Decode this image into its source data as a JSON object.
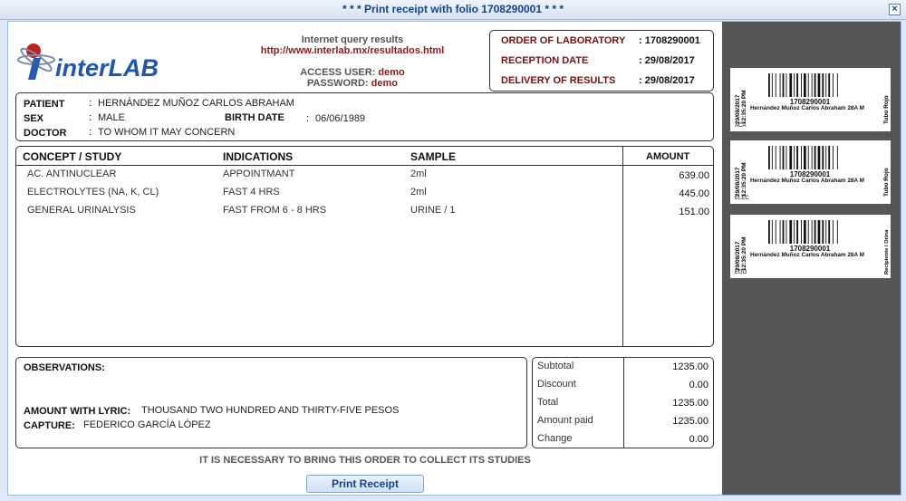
{
  "window": {
    "title": "* * * Print receipt with folio 1708290001 * * *",
    "close_symbol": "×"
  },
  "header": {
    "logo_text": "interLAB",
    "info_title": "Internet query results",
    "info_url": "http://www.interlab.mx/resultados.html",
    "access_user_label": "ACCESS USER:",
    "access_user_value": "demo",
    "password_label": "PASSWORD:",
    "password_value": "demo"
  },
  "order": {
    "order_label": "ORDER OF LABORATORY",
    "order_value": ": 1708290001",
    "reception_label": "RECEPTION DATE",
    "reception_value": ": 29/08/2017",
    "delivery_label": "DELIVERY OF RESULTS",
    "delivery_value": ": 29/08/2017"
  },
  "patient": {
    "patient_label": "PATIENT",
    "patient_value": "HERNÁNDEZ MUÑOZ CARLOS ABRAHAM",
    "sex_label": "SEX",
    "sex_value": "MALE",
    "birth_label": "BIRTH DATE",
    "birth_value": "06/06/1989",
    "doctor_label": "DOCTOR",
    "doctor_value": "TO WHOM IT MAY CONCERN",
    "colon": ":"
  },
  "items": {
    "headers": {
      "concept": "CONCEPT / STUDY",
      "indications": "INDICATIONS",
      "sample": "SAMPLE",
      "amount": "AMOUNT"
    },
    "rows": [
      {
        "concept": "AC. ANTINUCLEAR",
        "indications": "APPOINTMANT",
        "sample": "2ml",
        "amount": "639.00"
      },
      {
        "concept": "ELECTROLYTES (NA, K, CL)",
        "indications": "FAST 4 HRS",
        "sample": "2ml",
        "amount": "445.00"
      },
      {
        "concept": "GENERAL URINALYSIS",
        "indications": "FAST FROM 6 - 8 HRS",
        "sample": "URINE / 1",
        "amount": "151.00"
      }
    ]
  },
  "observations": {
    "label": "OBSERVATIONS:",
    "amount_lyric_label": "AMOUNT WITH LYRIC:",
    "amount_lyric_value": "THOUSAND TWO HUNDRED AND THIRTY-FIVE PESOS",
    "capture_label": "CAPTURE:",
    "capture_value": "FEDERICO GARCÍA LÓPEZ"
  },
  "totals": {
    "subtotal_label": "Subtotal",
    "subtotal_value": "1235.00",
    "discount_label": "Discount",
    "discount_value": "0.00",
    "total_label": "Total",
    "total_value": "1235.00",
    "paid_label": "Amount paid",
    "paid_value": "1235.00",
    "change_label": "Change",
    "change_value": "0.00"
  },
  "notice": "IT IS NECESSARY TO BRING THIS ORDER TO COLLECT ITS STUDIES",
  "print_button": "Print Receipt",
  "labels": [
    {
      "date": "29/08/2017",
      "time": "12:35:20 PM",
      "code": "ACA",
      "number": "1708290001",
      "name": "Hernández Muñoz Carlos Abraham 28A  M",
      "tube": "Tubo Rojo"
    },
    {
      "date": "29/08/2017",
      "time": "12:35:20 PM",
      "code": "ELEC",
      "number": "1708290001",
      "name": "Hernández Muñoz Carlos Abraham 28A  M",
      "tube": "Tubo Rojo"
    },
    {
      "date": "29/08/2017",
      "time": "12:35:20 PM",
      "code": "EGO",
      "number": "1708290001",
      "name": "Hernández Muñoz Carlos Abraham 28A  M",
      "tube": "Recipiente / Orina"
    }
  ],
  "colors": {
    "title_text": "#15428b",
    "label_red": "#7a1010",
    "side_panel": "#555756"
  }
}
